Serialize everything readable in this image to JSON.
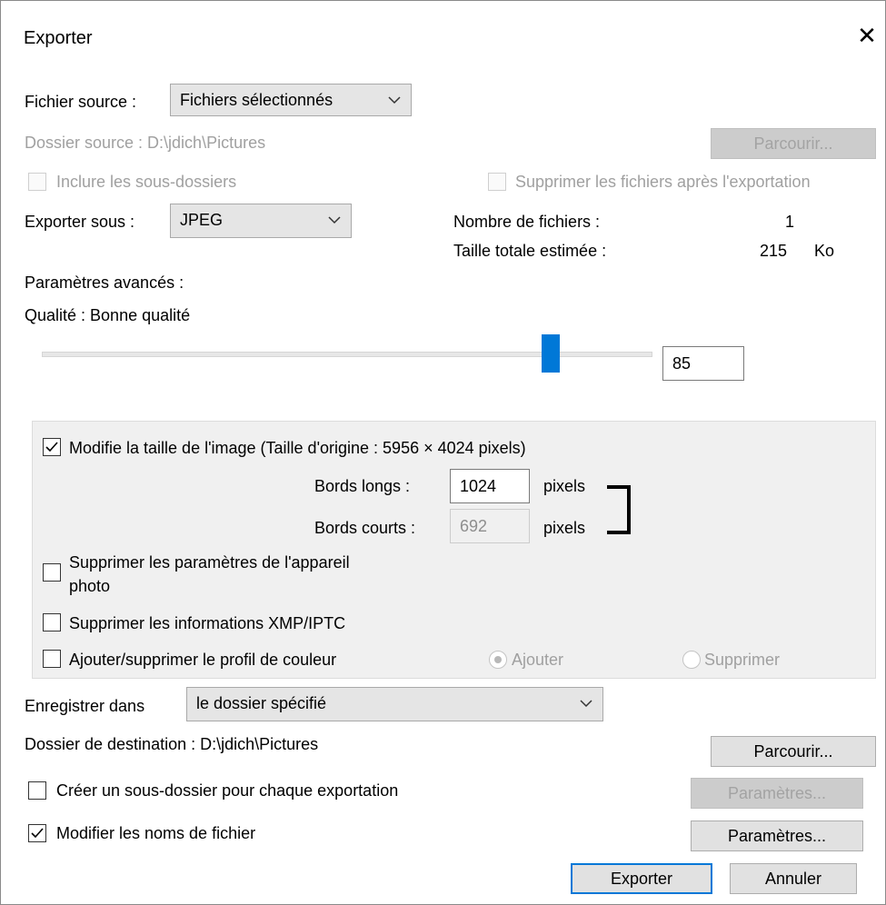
{
  "title": "Exporter",
  "close_label": "✕",
  "source": {
    "label": "Fichier source :",
    "value": "Fichiers sélectionnés",
    "folder_label": "Dossier source : D:\\jdich\\Pictures",
    "browse_label": "Parcourir...",
    "include_subfolders": "Inclure les sous-dossiers",
    "delete_after": "Supprimer les fichiers après l'exportation"
  },
  "format": {
    "label": "Exporter sous :",
    "value": "JPEG",
    "file_count_label": "Nombre de fichiers :",
    "file_count": "1",
    "total_size_label": "Taille totale estimée :",
    "total_size": "215",
    "size_unit": "Ko"
  },
  "advanced": {
    "label": "Paramètres avancés :",
    "quality_label": "Qualité : Bonne qualité",
    "quality_value": "85",
    "quality_fraction": 0.85
  },
  "resize": {
    "checkbox_label": "Modifie la taille de l'image (Taille d'origine : 5956 × 4024 pixels)",
    "long_label": "Bords longs :",
    "long_value": "1024",
    "short_label": "Bords courts :",
    "short_value": "692",
    "unit": "pixels"
  },
  "options": {
    "remove_camera_line1": "Supprimer les paramètres de l'appareil",
    "remove_camera_line2": "photo",
    "remove_xmp": "Supprimer les informations XMP/IPTC",
    "color_profile": "Ajouter/supprimer le profil de couleur",
    "add_label": "Ajouter",
    "remove_label": "Supprimer"
  },
  "destination": {
    "save_in_label": "Enregistrer dans",
    "save_in_value": "le dossier spécifié",
    "folder_label": "Dossier de destination : D:\\jdich\\Pictures",
    "browse_label": "Parcourir...",
    "subfolder_label": "Créer un sous-dossier pour chaque exportation",
    "subfolder_settings": "Paramètres...",
    "rename_label": "Modifier les noms de fichier",
    "rename_settings": "Paramètres..."
  },
  "footer": {
    "export_label": "Exporter",
    "cancel_label": "Annuler"
  }
}
